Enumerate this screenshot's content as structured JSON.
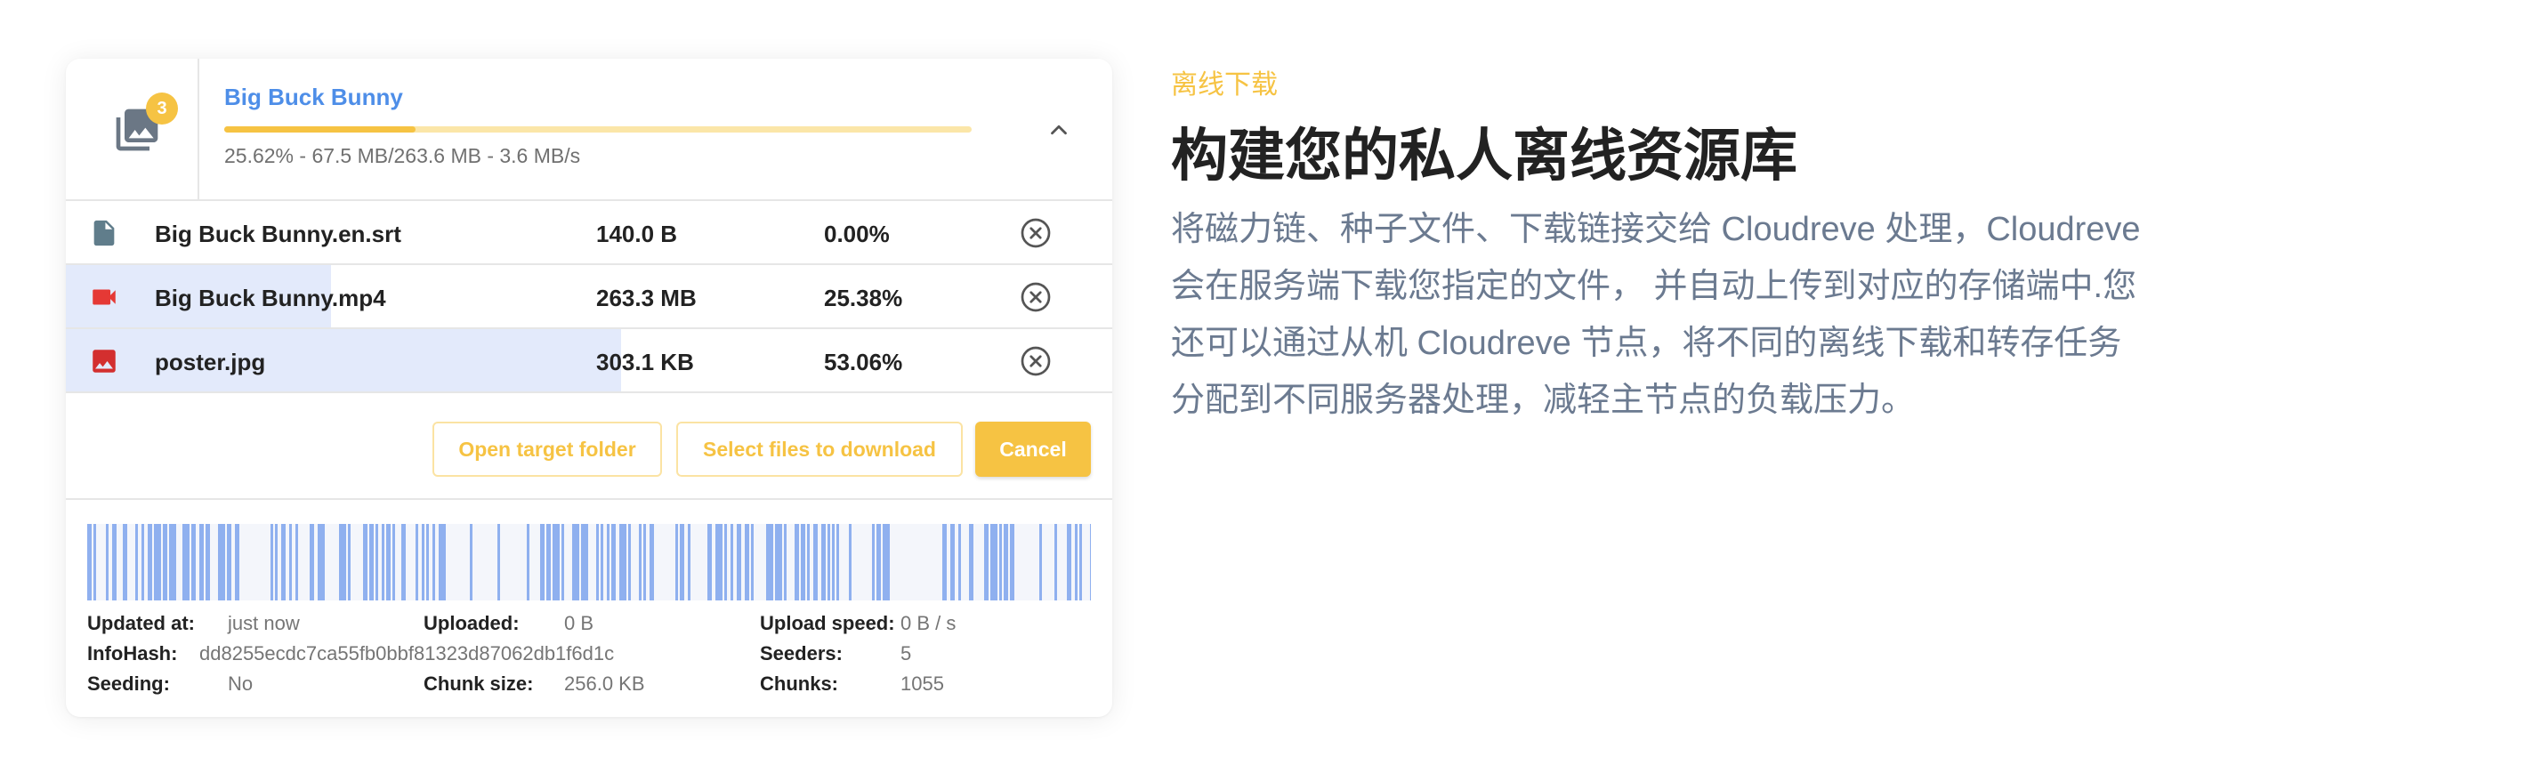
{
  "task": {
    "title": "Big Buck Bunny",
    "badge": "3",
    "progress": 0.2562,
    "progress_text": "25.62% - 67.5 MB/263.6 MB - 3.6 MB/s"
  },
  "files": [
    {
      "name": "Big Buck Bunny.en.srt",
      "size": "140.0 B",
      "percent": "0.00%",
      "progress": 0.0,
      "icon": "document-icon",
      "icon_color": "#607d8b"
    },
    {
      "name": "Big Buck Bunny.mp4",
      "size": "263.3 MB",
      "percent": "25.38%",
      "progress": 0.2538,
      "icon": "video-icon",
      "icon_color": "#e53935"
    },
    {
      "name": "poster.jpg",
      "size": "303.1 KB",
      "percent": "53.06%",
      "progress": 0.5306,
      "icon": "image-icon",
      "icon_color": "#d32f2f"
    }
  ],
  "actions": {
    "open_folder": "Open target folder",
    "select_files": "Select files to download",
    "cancel": "Cancel"
  },
  "details": {
    "updated_at_label": "Updated at:",
    "updated_at": "just now",
    "uploaded_label": "Uploaded:",
    "uploaded": "0 B",
    "upload_speed_label": "Upload speed:",
    "upload_speed": "0 B / s",
    "infohash_label": "InfoHash:",
    "infohash": "dd8255ecdc7ca55fb0bbf81323d87062db1f6d1c",
    "seeders_label": "Seeders:",
    "seeders": "5",
    "seeding_label": "Seeding:",
    "seeding": "No",
    "chunk_size_label": "Chunk size:",
    "chunk_size": "256.0 KB",
    "chunks_label": "Chunks:",
    "chunks": "1055"
  },
  "feature": {
    "eyebrow": "离线下载",
    "headline": "构建您的私人离线资源库",
    "lines": [
      "将磁力链、种子文件、下载链接交给 Cloudreve 处理，Cloudreve",
      "会在服务端下载您指定的文件， 并自动上传到对应的存储端中.您",
      "还可以通过从机 Cloudreve 节点，将不同的离线下载和转存任务",
      "分配到不同服务器处理，减轻主节点的负载压力。"
    ]
  },
  "colors": {
    "accent": "#f6c343",
    "title_blue": "#4e8ee8",
    "chunk_blue": "#8fb0ef",
    "row_progress": "#e3eafb",
    "desc_gray": "#6b7a90"
  }
}
